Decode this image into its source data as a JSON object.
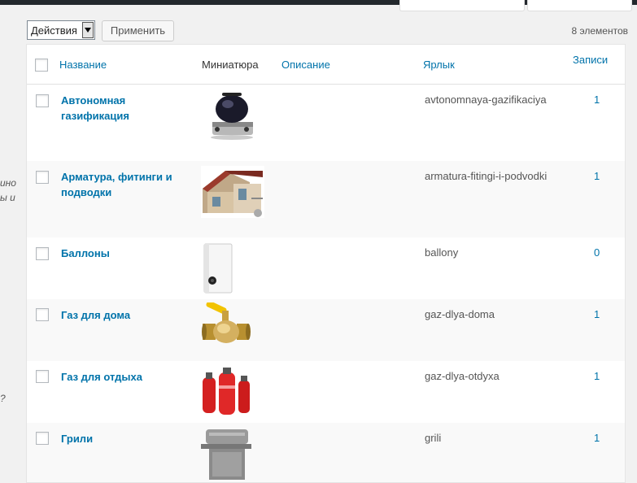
{
  "bulk_actions": {
    "label": "Действия",
    "apply_label": "Применить"
  },
  "count_label": "8 элементов",
  "edge_text": [
    "ино",
    "ы и",
    "?"
  ],
  "columns": {
    "name": "Название",
    "thumbnail": "Миниатюра",
    "description": "Описание",
    "slug": "Ярлык",
    "posts": "Записи"
  },
  "rows": [
    {
      "name": "Автономная газификация",
      "slug": "avtonomnaya-gazifikaciya",
      "posts": "1",
      "thumb": "gas-stove-thumbnail"
    },
    {
      "name": "Арматура, фитинги и подводки",
      "slug": "armatura-fitingi-i-podvodki",
      "posts": "1",
      "thumb": "house-gas-pipes-thumbnail"
    },
    {
      "name": "Баллоны",
      "slug": "ballony",
      "posts": "0",
      "thumb": "water-heater-thumbnail"
    },
    {
      "name": "Газ для дома",
      "slug": "gaz-dlya-doma",
      "posts": "1",
      "thumb": "ball-valve-thumbnail"
    },
    {
      "name": "Газ для отдыха",
      "slug": "gaz-dlya-otdyxa",
      "posts": "1",
      "thumb": "gas-cylinders-thumbnail"
    },
    {
      "name": "Грили",
      "slug": "grili",
      "posts": "1",
      "thumb": "grill-thumbnail"
    }
  ]
}
